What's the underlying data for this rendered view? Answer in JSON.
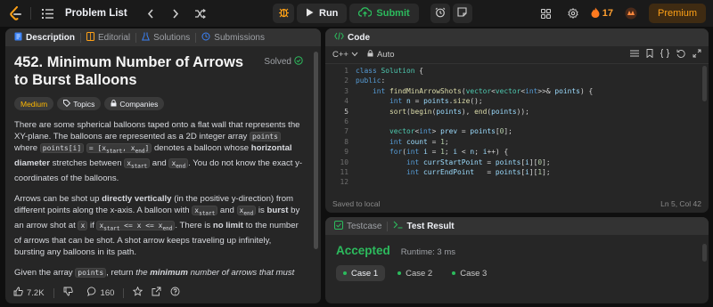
{
  "navbar": {
    "title": "Problem List",
    "run_label": "Run",
    "submit_label": "Submit",
    "streak_count": "17",
    "premium_label": "Premium"
  },
  "left_panel": {
    "tabs": [
      "Description",
      "Editorial",
      "Solutions",
      "Submissions"
    ],
    "problem_title": "452. Minimum Number of Arrows to Burst Balloons",
    "solved_label": "Solved",
    "tags": [
      "Medium",
      "Topics",
      "Companies"
    ],
    "p1": {
      "a": "There are some spherical balloons taped onto a flat wall that represents the XY-plane. The balloons are represented as a 2D integer array ",
      "code1": "points",
      "b": " where ",
      "code2": "points[i]",
      "code3": "= [x",
      "code3_sub": "start",
      "code3_b": ", x",
      "code3_sub2": "end",
      "code3_c": "]",
      "c": " denotes a balloon whose ",
      "bold": "horizontal diameter",
      "d": " stretches between ",
      "x1": "x",
      "x1_sub": "start",
      "e": " and ",
      "x2": "x",
      "x2_sub": "end",
      "f": ". You do not know the exact y-coordinates of the balloons."
    },
    "p2": {
      "a": "Arrows can be shot up ",
      "bold1": "directly vertically",
      "b": " (in the positive y-direction) from different points along the x-axis. A balloon with ",
      "x1": "x",
      "x1_sub": "start",
      "c": " and ",
      "x2": "x",
      "x2_sub": "end",
      "d": " is ",
      "bold2": "burst",
      "e": " by an arrow shot at ",
      "x3": "x",
      "f": " if ",
      "ineq_a": "x",
      "ineq_sub1": "start",
      "ineq_b": " <= x <= x",
      "ineq_sub2": "end",
      "g": ". There is ",
      "bold3": "no limit",
      "h": " to the number of arrows that can be shot. A shot arrow keeps traveling up infinitely, bursting any balloons in its path."
    },
    "p3": {
      "a": "Given the array ",
      "code": "points",
      "b": ", return ",
      "em_pre": "the ",
      "em_bold": "minimum",
      "em_post": " number of arrows that must be shot to burst all balloons",
      "c": "."
    },
    "footer": {
      "likes": "7.2K",
      "comments": "160"
    }
  },
  "code_panel": {
    "header": "Code",
    "language": "C++",
    "mode": "Auto",
    "current_line": 5,
    "lines": [
      {
        "n": "1",
        "t": "class Solution {"
      },
      {
        "n": "2",
        "t": "public:"
      },
      {
        "n": "3",
        "t": "    int findMinArrowShots(vector<vector<int>>& points) {"
      },
      {
        "n": "4",
        "t": "        int n = points.size();"
      },
      {
        "n": "5",
        "t": "        sort(begin(points), end(points));"
      },
      {
        "n": "6",
        "t": ""
      },
      {
        "n": "7",
        "t": "        vector<int> prev = points[0];"
      },
      {
        "n": "8",
        "t": "        int count = 1;"
      },
      {
        "n": "9",
        "t": "        for(int i = 1; i < n; i++) {"
      },
      {
        "n": "10",
        "t": "            int currStartPoint = points[i][0];"
      },
      {
        "n": "11",
        "t": "            int currEndPoint   = points[i][1];"
      },
      {
        "n": "12",
        "t": ""
      }
    ],
    "status_left": "Saved to local",
    "status_right": "Ln 5, Col 42"
  },
  "test_panel": {
    "tabs": [
      "Testcase",
      "Test Result"
    ],
    "result": "Accepted",
    "runtime": "Runtime: 3 ms",
    "cases": [
      "Case 1",
      "Case 2",
      "Case 3"
    ]
  },
  "colors": {
    "accent_green": "#2cbb5d",
    "medium_yellow": "#ffb800",
    "premium_orange": "#ffa116"
  }
}
